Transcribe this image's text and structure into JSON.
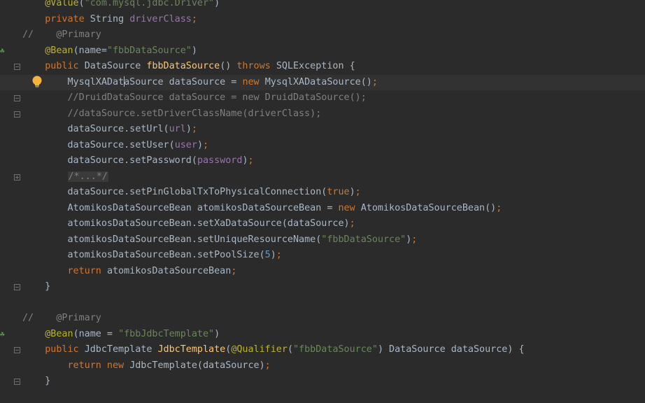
{
  "lines": [
    {
      "parts": [
        {
          "t": "    "
        },
        {
          "c": "ann",
          "t": "@Value"
        },
        {
          "t": "("
        },
        {
          "c": "str",
          "t": "\"com.mysql.jdbc.Driver\""
        },
        {
          "t": ")"
        }
      ]
    },
    {
      "parts": [
        {
          "t": "    "
        },
        {
          "c": "kw",
          "t": "private "
        },
        {
          "t": "String "
        },
        {
          "c": "fld",
          "t": "driverClass"
        },
        {
          "c": "kw",
          "t": ";"
        }
      ]
    },
    {
      "parts": [
        {
          "c": "cmt",
          "t": "//    @Primary"
        }
      ]
    },
    {
      "parts": [
        {
          "t": "    "
        },
        {
          "c": "ann",
          "t": "@Bean"
        },
        {
          "t": "("
        },
        {
          "t": "name"
        },
        {
          "t": "="
        },
        {
          "c": "str",
          "t": "\"fbbDataSource\""
        },
        {
          "t": ")"
        }
      ]
    },
    {
      "parts": [
        {
          "t": "    "
        },
        {
          "c": "kw",
          "t": "public "
        },
        {
          "t": "DataSource "
        },
        {
          "c": "fn",
          "t": "fbbDataSource"
        },
        {
          "t": "() "
        },
        {
          "c": "kw",
          "t": "throws "
        },
        {
          "t": "SQLException {"
        }
      ]
    },
    {
      "parts": [
        {
          "t": "        "
        },
        {
          "t": "MysqlXADat"
        },
        {
          "caret": true
        },
        {
          "t": "aSource dataSource = "
        },
        {
          "c": "kw",
          "t": "new "
        },
        {
          "t": "MysqlXADataSource()"
        },
        {
          "c": "kw",
          "t": ";"
        }
      ]
    },
    {
      "parts": [
        {
          "t": "        "
        },
        {
          "c": "cmt",
          "t": "//DruidDataSource dataSource = new DruidDataSource();"
        }
      ]
    },
    {
      "parts": [
        {
          "t": "        "
        },
        {
          "c": "cmt",
          "t": "//dataSource.setDriverClassName(driverClass);"
        }
      ]
    },
    {
      "parts": [
        {
          "t": "        "
        },
        {
          "t": "dataSource.setUrl("
        },
        {
          "c": "fld",
          "t": "url"
        },
        {
          "t": ")"
        },
        {
          "c": "kw",
          "t": ";"
        }
      ]
    },
    {
      "parts": [
        {
          "t": "        "
        },
        {
          "t": "dataSource.setUser("
        },
        {
          "c": "fld",
          "t": "user"
        },
        {
          "t": ")"
        },
        {
          "c": "kw",
          "t": ";"
        }
      ]
    },
    {
      "parts": [
        {
          "t": "        "
        },
        {
          "t": "dataSource.setPassword("
        },
        {
          "c": "fld",
          "t": "password"
        },
        {
          "t": ")"
        },
        {
          "c": "kw",
          "t": ";"
        }
      ]
    },
    {
      "parts": [
        {
          "t": "        "
        },
        {
          "c": "collapsed",
          "t": "/*...*/"
        }
      ]
    },
    {
      "parts": [
        {
          "t": "        "
        },
        {
          "t": "dataSource.setPinGlobalTxToPhysicalConnection("
        },
        {
          "c": "kw",
          "t": "true"
        },
        {
          "t": ")"
        },
        {
          "c": "kw",
          "t": ";"
        }
      ]
    },
    {
      "parts": [
        {
          "t": "        "
        },
        {
          "t": "AtomikosDataSourceBean atomikosDataSourceBean = "
        },
        {
          "c": "kw",
          "t": "new "
        },
        {
          "t": "AtomikosDataSourceBean()"
        },
        {
          "c": "kw",
          "t": ";"
        }
      ]
    },
    {
      "parts": [
        {
          "t": "        "
        },
        {
          "t": "atomikosDataSourceBean.setXaDataSource(dataSource)"
        },
        {
          "c": "kw",
          "t": ";"
        }
      ]
    },
    {
      "parts": [
        {
          "t": "        "
        },
        {
          "t": "atomikosDataSourceBean.setUniqueResourceName("
        },
        {
          "c": "str",
          "t": "\"fbbDataSource\""
        },
        {
          "t": ")"
        },
        {
          "c": "kw",
          "t": ";"
        }
      ]
    },
    {
      "parts": [
        {
          "t": "        "
        },
        {
          "t": "atomikosDataSourceBean.setPoolSize("
        },
        {
          "c": "num",
          "t": "5"
        },
        {
          "t": ")"
        },
        {
          "c": "kw",
          "t": ";"
        }
      ]
    },
    {
      "parts": [
        {
          "t": "        "
        },
        {
          "c": "kw",
          "t": "return "
        },
        {
          "t": "atomikosDataSourceBean"
        },
        {
          "c": "kw",
          "t": ";"
        }
      ]
    },
    {
      "parts": [
        {
          "t": "    }"
        }
      ]
    },
    {
      "parts": []
    },
    {
      "parts": [
        {
          "c": "cmt",
          "t": "//    @Primary"
        }
      ]
    },
    {
      "parts": [
        {
          "t": "    "
        },
        {
          "c": "ann",
          "t": "@Bean"
        },
        {
          "t": "(name = "
        },
        {
          "c": "str",
          "t": "\"fbbJdbcTemplate\""
        },
        {
          "t": ")"
        }
      ]
    },
    {
      "parts": [
        {
          "t": "    "
        },
        {
          "c": "kw",
          "t": "public "
        },
        {
          "t": "JdbcTemplate "
        },
        {
          "c": "fn",
          "t": "JdbcTemplate"
        },
        {
          "t": "("
        },
        {
          "c": "ann",
          "t": "@Qualifier"
        },
        {
          "t": "("
        },
        {
          "c": "str",
          "t": "\"fbbDataSource\""
        },
        {
          "t": ") DataSource dataSource) {"
        }
      ]
    },
    {
      "parts": [
        {
          "t": "        "
        },
        {
          "c": "kw",
          "t": "return new "
        },
        {
          "t": "JdbcTemplate(dataSource)"
        },
        {
          "c": "kw",
          "t": ";"
        }
      ]
    },
    {
      "parts": [
        {
          "t": "    }"
        }
      ]
    }
  ],
  "current_line": 5,
  "icons": {
    "bean_lines": [
      3,
      21
    ],
    "bulb_line": 5,
    "fold_open_lines": [
      4,
      6,
      22
    ],
    "fold_end_lines": [
      7,
      18,
      24
    ],
    "fold_collapsed_lines": [
      11
    ]
  }
}
